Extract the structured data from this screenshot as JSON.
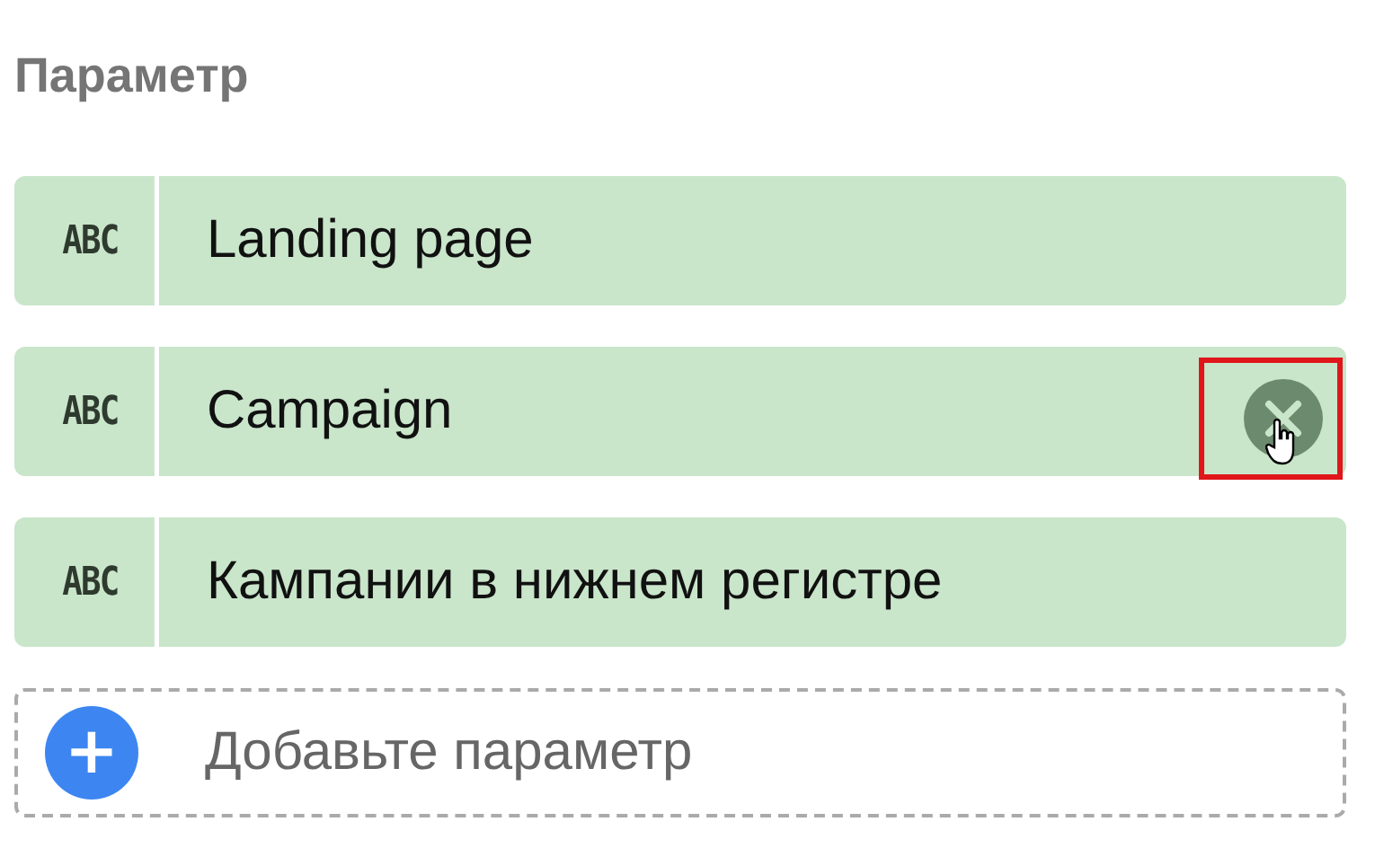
{
  "title": "Параметр",
  "parameters": [
    {
      "type_label": "ABC",
      "name": "Landing page",
      "hovered": false
    },
    {
      "type_label": "ABC",
      "name": "Campaign",
      "hovered": true
    },
    {
      "type_label": "ABC",
      "name": "Кампании в нижнем регистре",
      "hovered": false
    }
  ],
  "add": {
    "icon": "+",
    "label": "Добавьте параметр"
  }
}
